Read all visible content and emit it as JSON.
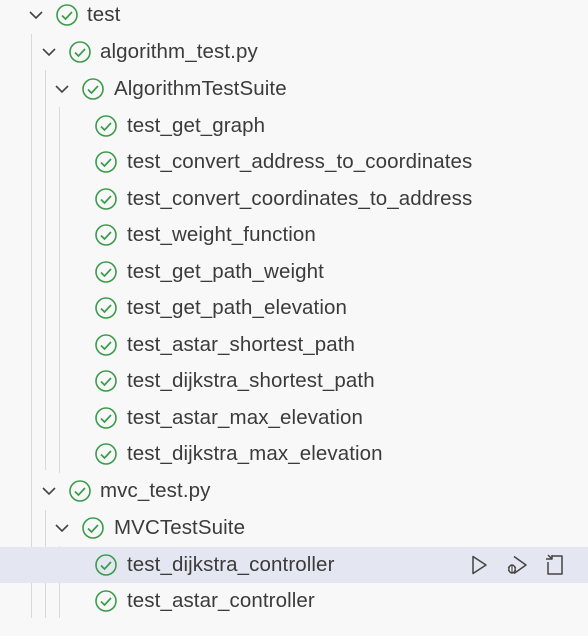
{
  "tree": {
    "root": {
      "label": "test"
    },
    "file1": {
      "label": "algorithm_test.py"
    },
    "suite1": {
      "label": "AlgorithmTestSuite"
    },
    "tests1": [
      "test_get_graph",
      "test_convert_address_to_coordinates",
      "test_convert_coordinates_to_address",
      "test_weight_function",
      "test_get_path_weight",
      "test_get_path_elevation",
      "test_astar_shortest_path",
      "test_dijkstra_shortest_path",
      "test_astar_max_elevation",
      "test_dijkstra_max_elevation"
    ],
    "file2": {
      "label": "mvc_test.py"
    },
    "suite2": {
      "label": "MVCTestSuite"
    },
    "tests2": [
      "test_dijkstra_controller",
      "test_astar_controller"
    ]
  },
  "status": {
    "icon": "check-circle-icon",
    "color": "#3a9c4a"
  },
  "selected_row": "test_dijkstra_controller",
  "row_actions": [
    "run-test-icon",
    "debug-test-icon",
    "go-to-test-icon"
  ]
}
